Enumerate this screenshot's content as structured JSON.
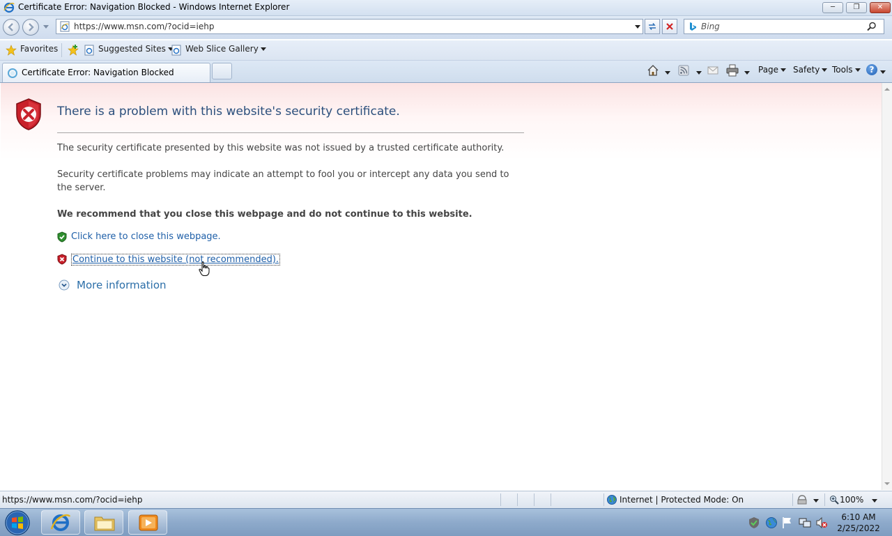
{
  "window": {
    "title": "Certificate Error: Navigation Blocked - Windows Internet Explorer",
    "controls": {
      "minimize": "─",
      "maximize": "❐",
      "close": "✕"
    }
  },
  "address_bar": {
    "url": "https://www.msn.com/?ocid=iehp",
    "search_placeholder": "Bing"
  },
  "favorites_bar": {
    "favorites_label": "Favorites",
    "items": [
      "Suggested Sites",
      "Web Slice Gallery"
    ]
  },
  "tabs": {
    "active_label": "Certificate Error: Navigation Blocked"
  },
  "command_bar": {
    "page_label": "Page",
    "safety_label": "Safety",
    "tools_label": "Tools",
    "help_label": "?"
  },
  "page": {
    "headline": "There is a problem with this website's security certificate.",
    "para1": "The security certificate presented by this website was not issued by a trusted certificate authority.",
    "para2": "Security certificate problems may indicate an attempt to fool you or intercept any data you send to the server.",
    "recommend": "We recommend that you close this webpage and do not continue to this website.",
    "close_link": "Click here to close this webpage.",
    "continue_link": "Continue to this website (not recommended).",
    "more_info": "More information"
  },
  "status_bar": {
    "url": "https://www.msn.com/?ocid=iehp",
    "zone": "Internet | Protected Mode: On",
    "zoom": "100%"
  },
  "taskbar": {
    "time": "6:10 AM",
    "date": "2/25/2022"
  },
  "colors": {
    "headline": "#2b4f7c",
    "link": "#1e5fa8",
    "error_red": "#c8202a",
    "safe_green": "#2f8f2f"
  }
}
